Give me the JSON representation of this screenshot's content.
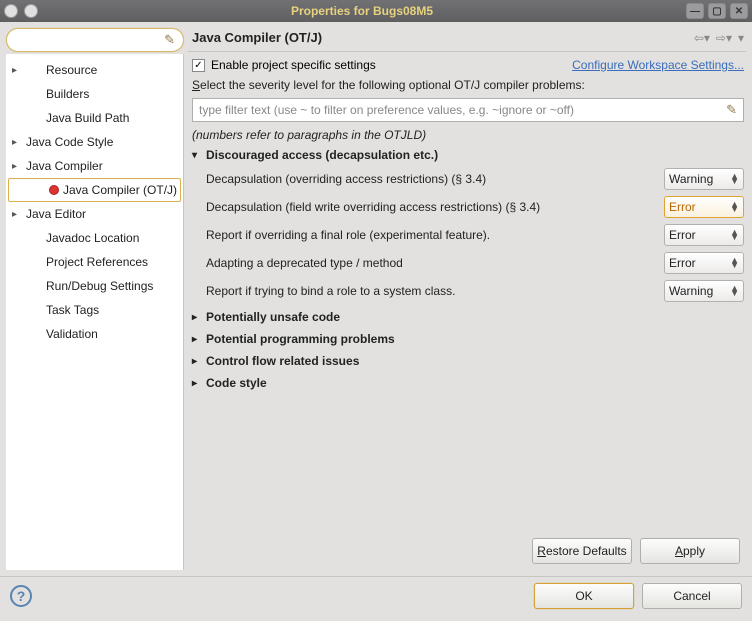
{
  "window": {
    "title": "Properties for Bugs08M5"
  },
  "sidebar": {
    "items": [
      {
        "label": "Resource",
        "expandable": true,
        "indent": 1
      },
      {
        "label": "Builders",
        "expandable": false,
        "indent": 1
      },
      {
        "label": "Java Build Path",
        "expandable": false,
        "indent": 1
      },
      {
        "label": "Java Code Style",
        "expandable": true,
        "indent": 0
      },
      {
        "label": "Java Compiler",
        "expandable": true,
        "indent": 0
      },
      {
        "label": "Java Compiler (OT/J)",
        "expandable": false,
        "indent": 1,
        "selected": true,
        "icon": "red-dot"
      },
      {
        "label": "Java Editor",
        "expandable": true,
        "indent": 0
      },
      {
        "label": "Javadoc Location",
        "expandable": false,
        "indent": 1
      },
      {
        "label": "Project References",
        "expandable": false,
        "indent": 1
      },
      {
        "label": "Run/Debug Settings",
        "expandable": false,
        "indent": 1
      },
      {
        "label": "Task Tags",
        "expandable": false,
        "indent": 1
      },
      {
        "label": "Validation",
        "expandable": false,
        "indent": 1
      }
    ]
  },
  "page": {
    "title": "Java Compiler (OT/J)",
    "enable_checkbox": {
      "checked": true,
      "label": "Enable project specific settings"
    },
    "configure_link": "Configure Workspace Settings...",
    "description": "Select the severity level for the following optional OT/J compiler problems:",
    "filter_placeholder": "type filter text (use ~ to filter on preference values, e.g. ~ignore or ~off)",
    "note": "(numbers refer to paragraphs in the OTJLD)",
    "groups": [
      {
        "expanded": true,
        "title": "Discouraged access (decapsulation etc.)",
        "items": [
          {
            "label": "Decapsulation (overriding access restrictions) (§ 3.4)",
            "value": "Warning",
            "highlight": false
          },
          {
            "label": "Decapsulation (field write overriding access restrictions) (§ 3.4)",
            "value": "Error",
            "highlight": true
          },
          {
            "label": "Report if overriding a final role (experimental feature).",
            "value": "Error",
            "highlight": false
          },
          {
            "label": "Adapting a deprecated type / method",
            "value": "Error",
            "highlight": false
          },
          {
            "label": "Report if trying to bind a role to a system class.",
            "value": "Warning",
            "highlight": false
          }
        ]
      },
      {
        "expanded": false,
        "title": "Potentially unsafe code"
      },
      {
        "expanded": false,
        "title": "Potential programming problems"
      },
      {
        "expanded": false,
        "title": "Control flow related issues"
      },
      {
        "expanded": false,
        "title": "Code style"
      }
    ],
    "buttons": {
      "restore_defaults": "Restore Defaults",
      "apply": "Apply"
    }
  },
  "footer": {
    "ok": "OK",
    "cancel": "Cancel"
  }
}
